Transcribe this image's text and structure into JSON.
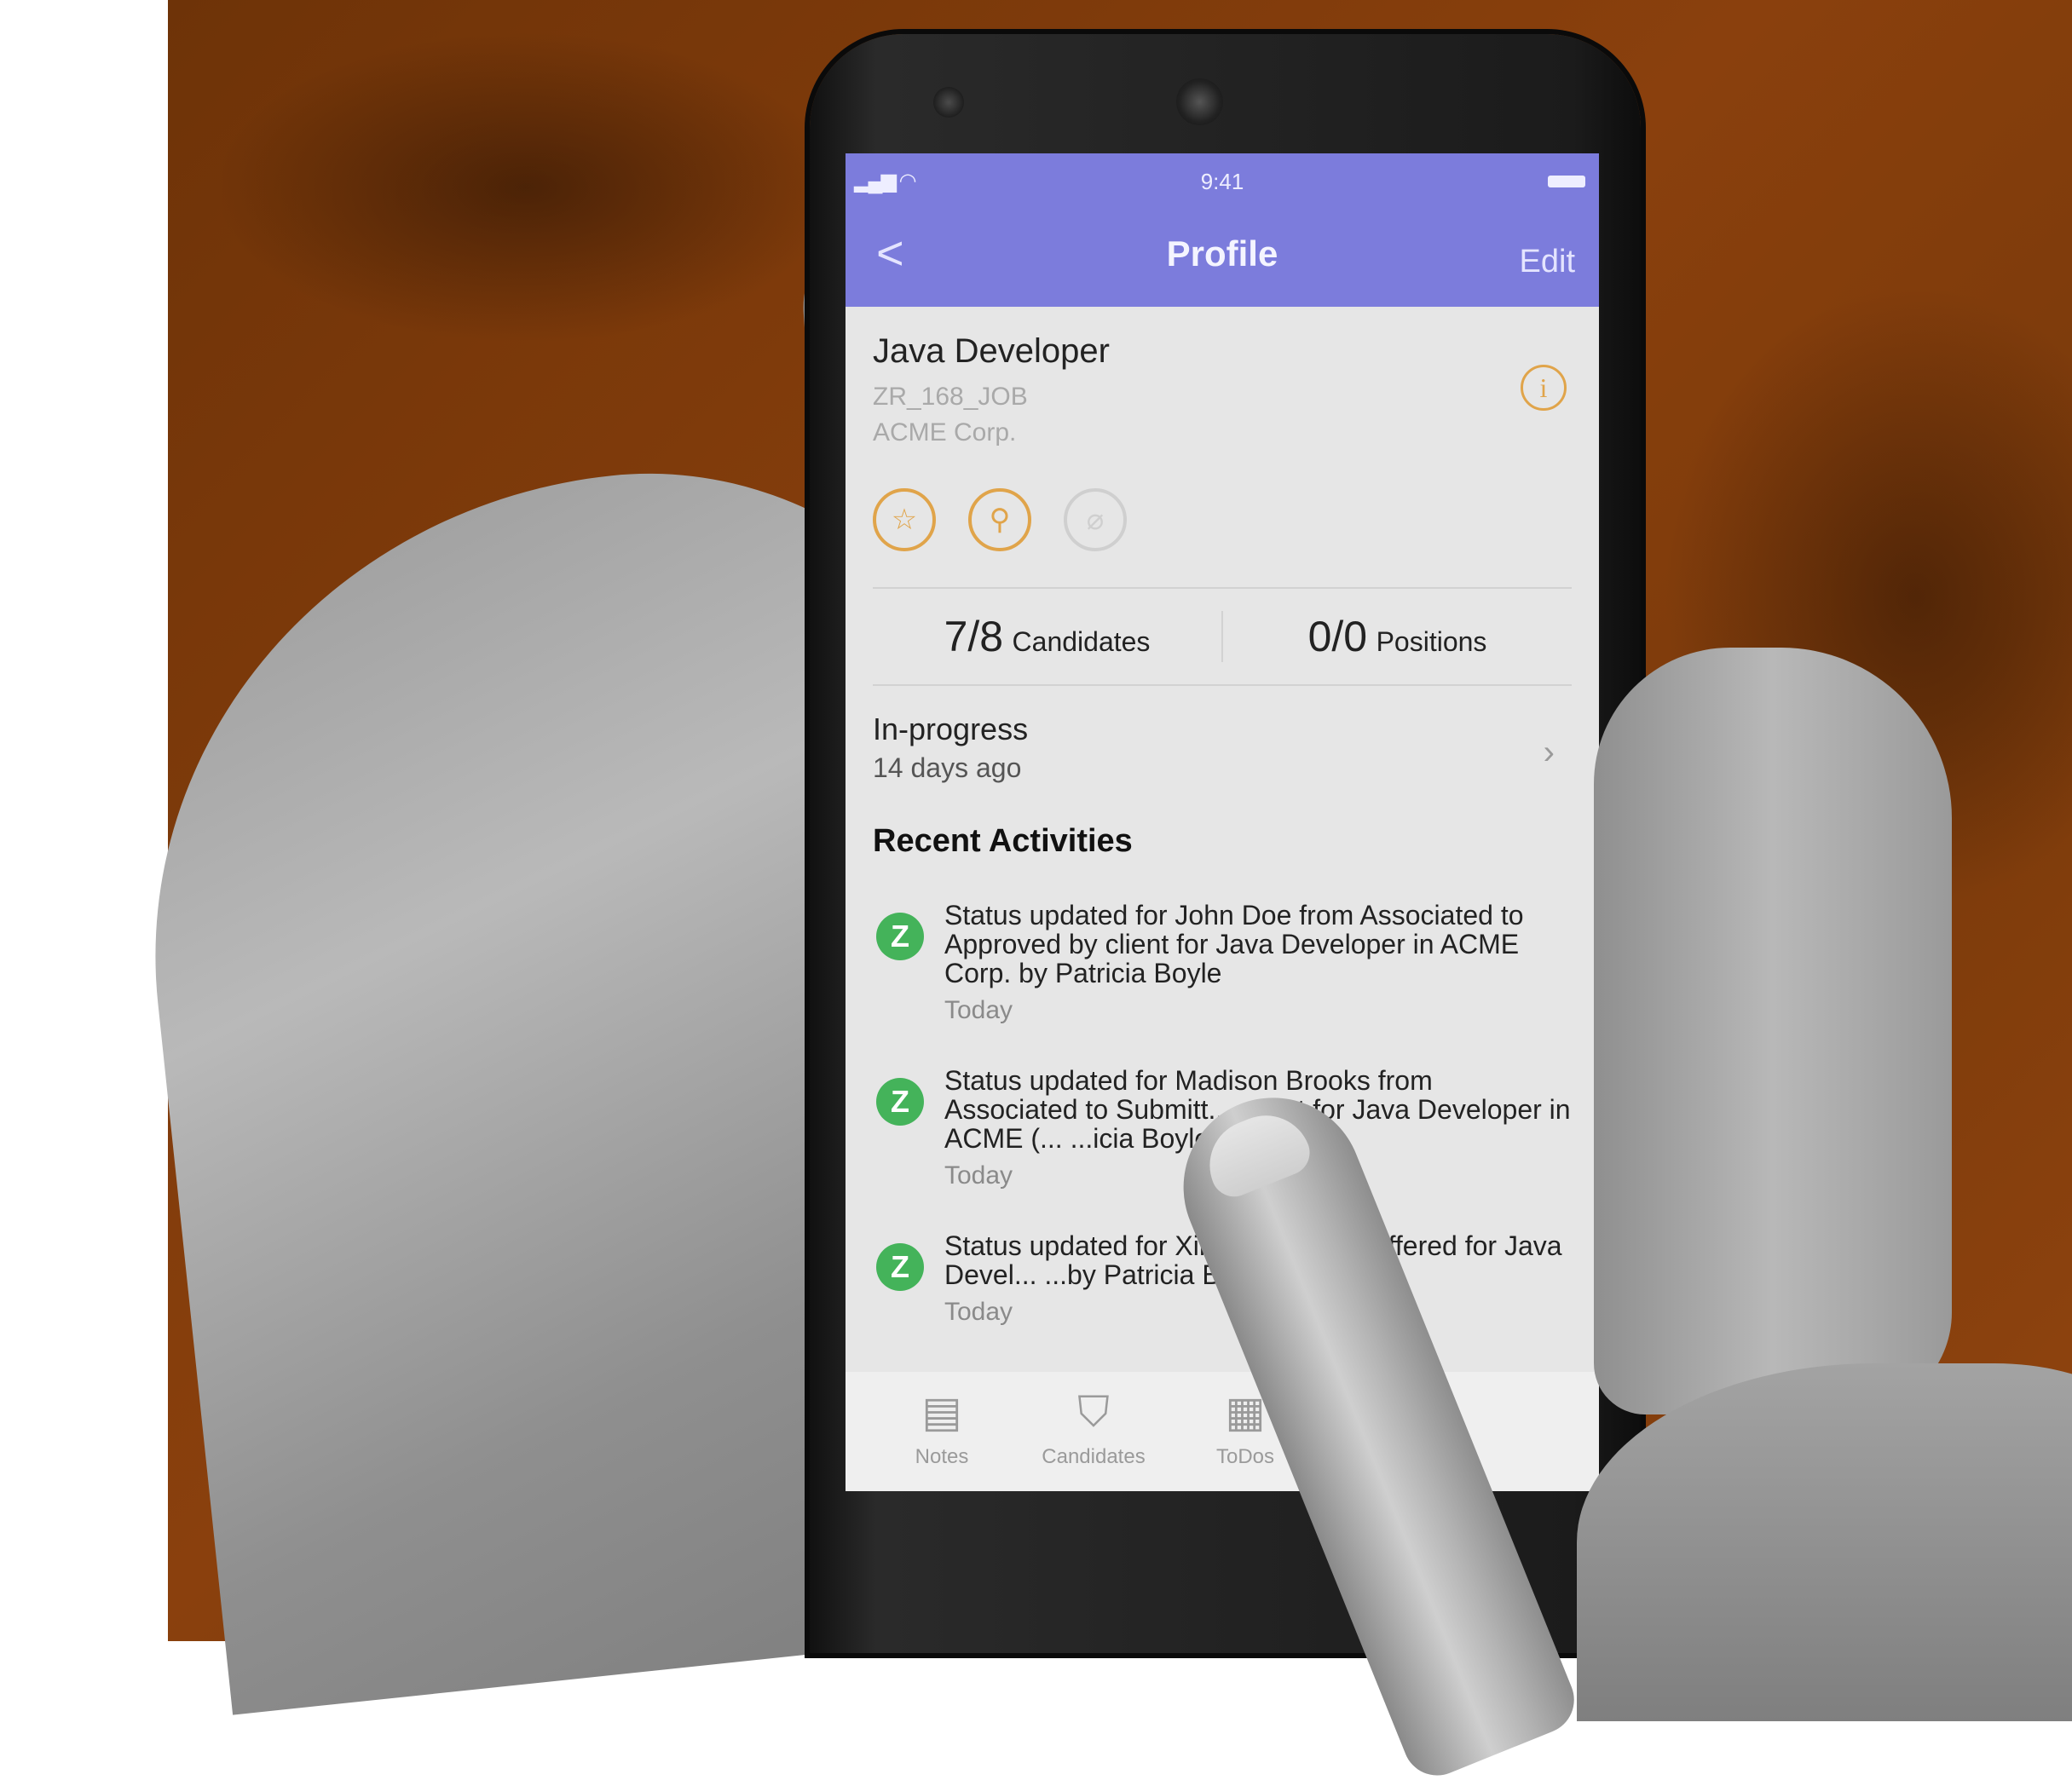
{
  "status_bar": {
    "time": "9:41"
  },
  "nav": {
    "back": "<",
    "title": "Profile",
    "edit": "Edit"
  },
  "job": {
    "title": "Java Developer",
    "code": "ZR_168_JOB",
    "company": "ACME Corp."
  },
  "actions": [
    {
      "icon": "star-icon",
      "glyph": "☆"
    },
    {
      "icon": "location-pin-icon",
      "glyph": "⚲"
    },
    {
      "icon": "paperclip-icon",
      "glyph": "⌀"
    }
  ],
  "stats": {
    "candidates_value": "7/8",
    "candidates_label": "Candidates",
    "positions_value": "0/0",
    "positions_label": "Positions"
  },
  "progress": {
    "status": "In-progress",
    "time": "14 days ago"
  },
  "recent": {
    "title": "Recent Activities",
    "items": [
      {
        "badge": "Z",
        "text": "Status updated for John Doe from Associated to Approved by client for Java Developer in ACME Corp. by Patricia Boyle",
        "time": "Today"
      },
      {
        "badge": "Z",
        "text": "Status updated for Madison Brooks from Associated to Submitt... ...ient for Java Developer in ACME (... ...icia Boyle",
        "time": "Today"
      },
      {
        "badge": "Z",
        "text": "Status updated for Xir... ...to To-be-Offered for Java Devel... ...by Patricia Boyle",
        "time": "Today"
      }
    ]
  },
  "tabs": [
    {
      "label": "Notes",
      "icon": "notes-icon",
      "glyph": "▤"
    },
    {
      "label": "Candidates",
      "icon": "graduation-cap-icon",
      "glyph": "⛉"
    },
    {
      "label": "ToDos",
      "icon": "calendar-clock-icon",
      "glyph": "▦"
    }
  ],
  "colors": {
    "header": "#7c7cdc",
    "accent": "#e0a44a",
    "badge": "#44b35a",
    "background": "#8a400d"
  }
}
